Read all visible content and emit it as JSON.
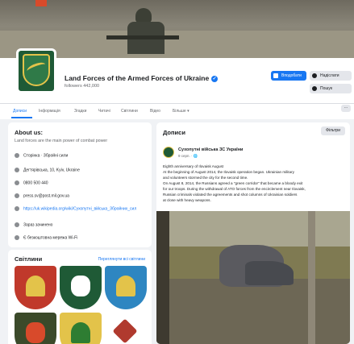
{
  "header": {
    "page_name": "Land Forces of the Armed Forces of Ukraine",
    "verified_mark": "✓",
    "followers": "followers 442,000",
    "buttons": {
      "like": "Вподобати",
      "message": "Надіслати",
      "search": "Пошук"
    }
  },
  "tabs": [
    "Дописи",
    "Інформація",
    "Згадки",
    "Читачі",
    "Світлини",
    "Відео",
    "Більше ▾"
  ],
  "more_label": "···",
  "about": {
    "title": "About us:",
    "description": "Land forces are the main power of combat power",
    "rows": [
      {
        "text": "Сторінка · Збройні сили",
        "icon": "info-icon",
        "is_link": false
      },
      {
        "text": "Дегтярівська, 10, Kyiv, Ukraine",
        "icon": "location-icon",
        "is_link": false
      },
      {
        "text": "0800 500 440",
        "icon": "phone-icon",
        "is_link": false
      },
      {
        "text": "press.sv@post.mil.gov.ua",
        "icon": "email-icon",
        "is_link": false
      },
      {
        "text": "https://uk.wikipedia.org/wiki/Сухопутні_війська_Збройних_сил",
        "icon": "link-icon",
        "is_link": true
      },
      {
        "text": "Зараз зачинено",
        "icon": "clock-icon",
        "is_link": false
      },
      {
        "text": "Є безкоштовна мережа Wi-Fi",
        "icon": "wifi-icon",
        "is_link": false
      }
    ]
  },
  "gallery": {
    "title": "Світлини",
    "see_all": "Переглянути всі світлини",
    "emblems": [
      {
        "color": "#c0392b",
        "mark_color": "#e3c34a",
        "icon": "crossed-arrows-emblem-icon"
      },
      {
        "color": "#1f5a36",
        "mark_color": "#ffffff",
        "icon": "knight-helmet-emblem-icon"
      },
      {
        "color": "#2e86c1",
        "mark_color": "#e3c34a",
        "icon": "lion-emblem-icon"
      },
      {
        "color": "#3b4a2a",
        "mark_color": "#d84a2b",
        "icon": "skull-emblem-icon"
      },
      {
        "color": "#e3c34a",
        "mark_color": "#2e7d32",
        "icon": "oak-leaves-emblem-icon"
      },
      {
        "color": "#ffffff",
        "mark_color": "#b03a2e",
        "icon": "cross-emblem-icon"
      }
    ]
  },
  "posts": {
    "title": "Дописи",
    "filter": "Фільтри",
    "post": {
      "author": "Сухопутні війська ЗС України",
      "time": "9 серп. · 🌐",
      "lines": [
        "Eighth anniversary of Ilovaisk August",
        "At the beginning of August 2014, the Ilovaisk operation began. Ukrainian military",
        "and volunteers stormed the city for the second time.",
        "On August 8, 2014, the Russians agreed a \"green corridor\" that became a bloody exit",
        "for our troops. During the withdrawal of ATO forces from the encirclement near Ilovaisk,",
        "Russian criminals violated the agreements and shot columns of Ukrainian soldiers",
        "at close with heavy weapons."
      ]
    }
  }
}
